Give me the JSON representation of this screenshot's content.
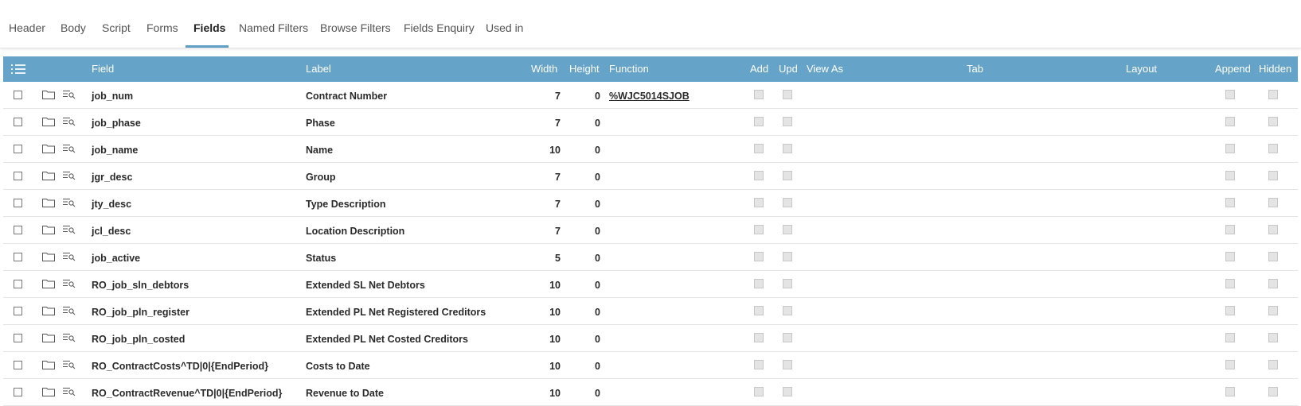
{
  "tabs": [
    {
      "label": "Header"
    },
    {
      "label": "Body"
    },
    {
      "label": "Script"
    },
    {
      "label": "Forms"
    },
    {
      "label": "Fields"
    },
    {
      "label": "Named Filters"
    },
    {
      "label": "Browse Filters"
    },
    {
      "label": "Fields Enquiry"
    },
    {
      "label": "Used in"
    }
  ],
  "active_tab": "Fields",
  "columns": {
    "field": "Field",
    "label": "Label",
    "width": "Width",
    "height": "Height",
    "function": "Function",
    "add": "Add",
    "upd": "Upd",
    "view_as": "View As",
    "tab": "Tab",
    "layout": "Layout",
    "append": "Append",
    "hidden": "Hidden"
  },
  "rows": [
    {
      "field": "job_num",
      "label": "Contract Number",
      "width": "7",
      "height": "0",
      "function": "%WJC5014SJOB"
    },
    {
      "field": "job_phase",
      "label": "Phase",
      "width": "7",
      "height": "0",
      "function": ""
    },
    {
      "field": "job_name",
      "label": "Name",
      "width": "10",
      "height": "0",
      "function": ""
    },
    {
      "field": "jgr_desc",
      "label": "Group",
      "width": "7",
      "height": "0",
      "function": ""
    },
    {
      "field": "jty_desc",
      "label": "Type Description",
      "width": "7",
      "height": "0",
      "function": ""
    },
    {
      "field": "jcl_desc",
      "label": "Location Description",
      "width": "7",
      "height": "0",
      "function": ""
    },
    {
      "field": "job_active",
      "label": "Status",
      "width": "5",
      "height": "0",
      "function": ""
    },
    {
      "field": "RO_job_sln_debtors",
      "label": "Extended SL Net Debtors",
      "width": "10",
      "height": "0",
      "function": ""
    },
    {
      "field": "RO_job_pln_register",
      "label": "Extended PL Net Registered Creditors",
      "width": "10",
      "height": "0",
      "function": ""
    },
    {
      "field": "RO_job_pln_costed",
      "label": "Extended PL Net Costed Creditors",
      "width": "10",
      "height": "0",
      "function": ""
    },
    {
      "field": "RO_ContractCosts^TD|0|{EndPeriod}",
      "label": "Costs to Date",
      "width": "10",
      "height": "0",
      "function": ""
    },
    {
      "field": "RO_ContractRevenue^TD|0|{EndPeriod}",
      "label": "Revenue to Date",
      "width": "10",
      "height": "0",
      "function": ""
    }
  ],
  "colors": {
    "header_bg": "#66a3c9",
    "accent": "#5f9fc6",
    "link": "#4a9ad0"
  },
  "icons": {
    "menu": "list-menu-icon",
    "folder": "folder-icon",
    "lookup": "list-search-icon"
  }
}
